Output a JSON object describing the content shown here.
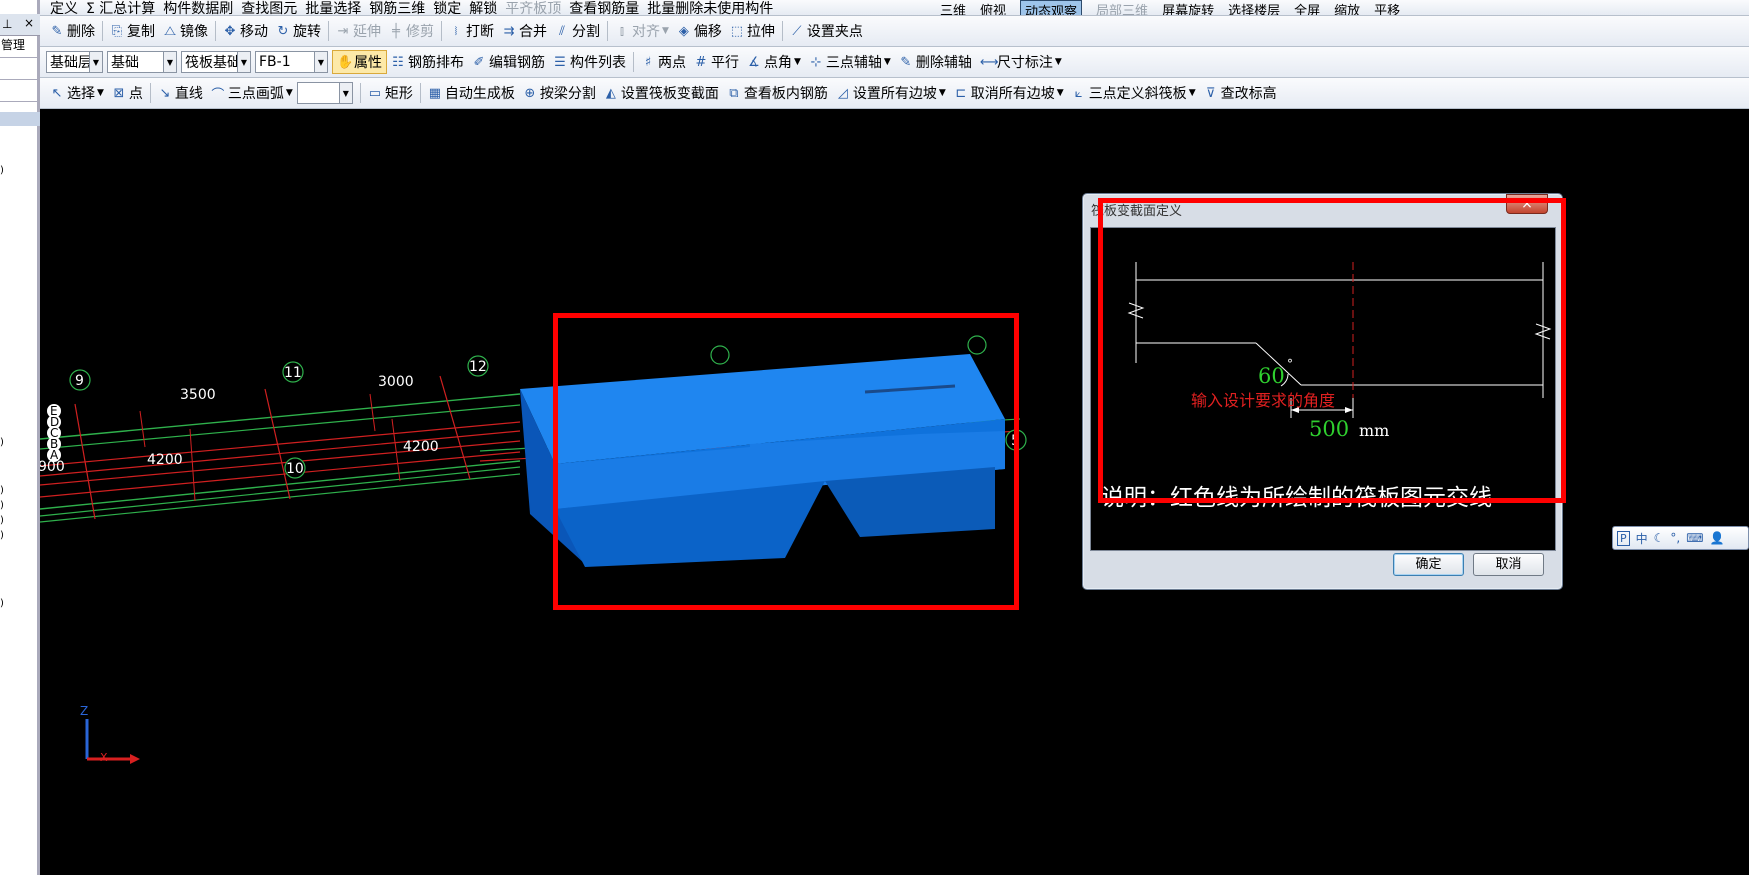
{
  "left_panel": {
    "pin": "⊥",
    "close": "×",
    "row1": "管理",
    "marks": [
      ")",
      ")",
      ")",
      ")",
      ")",
      ")",
      ")"
    ]
  },
  "toolbar0": {
    "items": [
      "定义",
      "Σ 汇总计算",
      "构件数据刷",
      "查找图元",
      "批量选择",
      "钢筋三维",
      "锁定",
      "解锁",
      "平齐板顶",
      "查看钢筋量",
      "批量删除未使用构件"
    ],
    "right": [
      "三维",
      "俯视",
      "动态观察",
      "局部三维",
      "屏幕旋转",
      "选择楼层",
      "全屏",
      "缩放",
      "平移"
    ]
  },
  "toolbar1": {
    "delete": "删除",
    "copy": "复制",
    "mirror": "镜像",
    "move": "移动",
    "rotate": "旋转",
    "extend": "延伸",
    "trim": "修剪",
    "break": "打断",
    "merge": "合并",
    "split": "分割",
    "align": "对齐",
    "offset": "偏移",
    "stretch": "拉伸",
    "set_grip": "设置夹点"
  },
  "toolbar2": {
    "sel1": "基础层",
    "sel2": "基础",
    "sel3": "筏板基础",
    "sel4": "FB-1",
    "properties": "属性",
    "rebar_layout": "钢筋排布",
    "edit_rebar": "编辑钢筋",
    "component_list": "构件列表",
    "two_points": "两点",
    "parallel": "平行",
    "point_angle": "点角",
    "three_point_axis": "三点辅轴",
    "delete_axis": "删除辅轴",
    "dimension": "尺寸标注"
  },
  "toolbar3": {
    "select": "选择",
    "point": "点",
    "line": "直线",
    "arc": "三点画弧",
    "arc_sel": "",
    "rect": "矩形",
    "auto_gen": "自动生成板",
    "split_by_beam": "按梁分割",
    "set_section": "设置筏板变截面",
    "view_rebar": "查看板内钢筋",
    "set_all_slopes": "设置所有边坡",
    "cancel_all_slopes": "取消所有边坡",
    "three_point_slope": "三点定义斜筏板",
    "edit_elev": "查改标高"
  },
  "canvas": {
    "axis_labels": [
      "9",
      "11",
      "12",
      "10",
      "5"
    ],
    "dims": [
      "3500",
      "3000",
      "4200",
      "4200",
      "900"
    ],
    "row_labels": [
      "E",
      "D",
      "C",
      "B",
      "A"
    ],
    "axis_z": "Z",
    "axis_x": "X"
  },
  "dialog": {
    "title": "筏板变截面定义",
    "close": "×",
    "angle_value": "60",
    "angle_unit": "°",
    "angle_hint": "输入设计要求的角度",
    "width_value": "500",
    "width_unit": "mm",
    "note": "说明：红色线为所绘制的筏板图元交线",
    "ok": "确定",
    "cancel": "取消"
  },
  "ime": {
    "logo": "P",
    "lang": "中"
  },
  "colors": {
    "slab": "#0a6fd6",
    "highlight": "#ff0000",
    "grid_green": "#2fb14c",
    "grid_red": "#d02020"
  }
}
